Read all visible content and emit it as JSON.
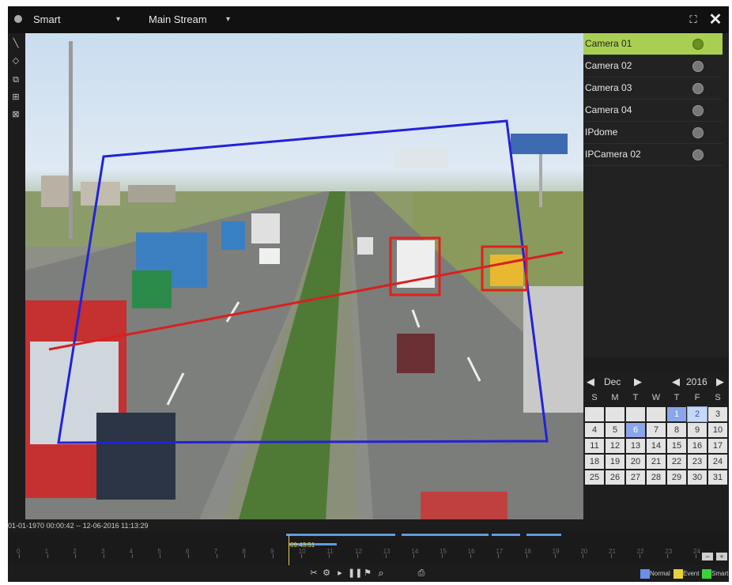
{
  "topbar": {
    "mode_label": "Smart",
    "stream_label": "Main Stream",
    "fullscreen_icon": "fullscreen-icon",
    "close_icon": "close-icon"
  },
  "tools": [
    "line-draw-tool-icon",
    "polygon-draw-tool-icon",
    "region-tool-icon",
    "full-screen-region-tool-icon",
    "clear-tool-icon"
  ],
  "cameras": [
    {
      "label": "Camera 01",
      "active": true
    },
    {
      "label": "Camera 02",
      "active": false
    },
    {
      "label": "Camera 03",
      "active": false
    },
    {
      "label": "Camera 04",
      "active": false
    },
    {
      "label": "IPdome",
      "active": false
    },
    {
      "label": "IPCamera 02",
      "active": false
    }
  ],
  "calendar": {
    "month": "Dec",
    "year": "2016",
    "dow": [
      "S",
      "M",
      "T",
      "W",
      "T",
      "F",
      "S"
    ],
    "rows": [
      [
        "",
        "",
        "",
        "",
        "1",
        "2",
        "3"
      ],
      [
        "4",
        "5",
        "6",
        "7",
        "8",
        "9",
        "10"
      ],
      [
        "11",
        "12",
        "13",
        "14",
        "15",
        "16",
        "17"
      ],
      [
        "18",
        "19",
        "20",
        "21",
        "22",
        "23",
        "24"
      ],
      [
        "25",
        "26",
        "27",
        "28",
        "29",
        "30",
        "31"
      ]
    ],
    "blue_days": [
      "1",
      "6"
    ],
    "selected_day": "2"
  },
  "timeline": {
    "range_text": "01-01-1970 00:00:42 -- 12-06-2016 11:13:29",
    "cursor_time": "09:43:51",
    "hour_labels": [
      "0",
      "1",
      "2",
      "3",
      "4",
      "5",
      "6",
      "7",
      "8",
      "9",
      "10",
      "11",
      "12",
      "13",
      "14",
      "15",
      "16",
      "17",
      "18",
      "19",
      "20",
      "21",
      "22",
      "23",
      "24"
    ]
  },
  "playback_controls": [
    "cut-icon",
    "settings-icon",
    "play-icon",
    "pause-icon",
    "tag-icon",
    "zoom-icon",
    "spacer",
    "export-icon"
  ],
  "legend": [
    {
      "label": "Normal",
      "color": "#6e8ee8"
    },
    {
      "label": "Event",
      "color": "#e8d23a"
    },
    {
      "label": "Smart",
      "color": "#3ad23a"
    }
  ],
  "colors": {
    "accent": "#a9cf52",
    "roi": "#2222d8",
    "line": "#d82020",
    "target": "#e02020"
  }
}
